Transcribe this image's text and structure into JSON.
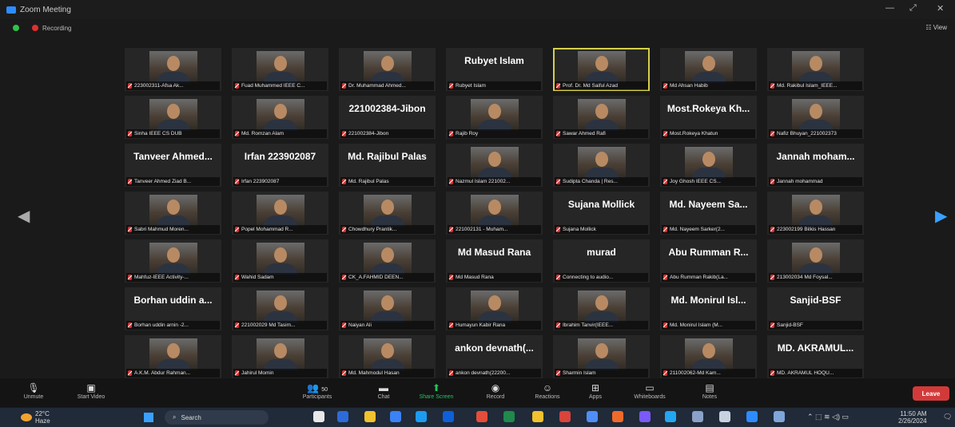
{
  "window": {
    "title": "Zoom Meeting",
    "status": "Recording",
    "view_label": "View"
  },
  "gallery": [
    {
      "name": "223002311-Afsa Ak...",
      "kind": "photo"
    },
    {
      "name": "Fuad Muhammed IEEE C...",
      "kind": "photo"
    },
    {
      "name": "Dr. Muhammad Ahmed...",
      "kind": "photo"
    },
    {
      "name": "Rubyet Islam",
      "kind": "text",
      "big": "Rubyet Islam"
    },
    {
      "name": "Prof. Dr. Md Saiful Azad",
      "kind": "photo",
      "active": true
    },
    {
      "name": "Md Ahsan Habib",
      "kind": "photo"
    },
    {
      "name": "Md. Rakibul Islam_IEEE...",
      "kind": "photo"
    },
    {
      "name": "Sinha IEEE CS DUB",
      "kind": "photo"
    },
    {
      "name": "Md. Romzan Alam",
      "kind": "photo"
    },
    {
      "name": "221002384-Jibon",
      "kind": "text",
      "big": "221002384-Jibon"
    },
    {
      "name": "Rajib Roy",
      "kind": "photo"
    },
    {
      "name": "Sawar Ahmed Rafi",
      "kind": "photo"
    },
    {
      "name": "Most.Rokeya Khatun",
      "kind": "text",
      "big": "Most.Rokeya Kh..."
    },
    {
      "name": "Nafiz Bhuyan_221002373",
      "kind": "photo"
    },
    {
      "name": "Tanveer Ahmed Ziad B...",
      "kind": "text",
      "big": "Tanveer Ahmed..."
    },
    {
      "name": "Irfan 223902087",
      "kind": "text",
      "big": "Irfan 223902087"
    },
    {
      "name": "Md. Rajibul Palas",
      "kind": "text",
      "big": "Md. Rajibul Palas"
    },
    {
      "name": "Nazmul Islam 221002...",
      "kind": "photo"
    },
    {
      "name": "Sudipta Chanda | Res...",
      "kind": "photo"
    },
    {
      "name": "Joy Ghosh IEEE CS...",
      "kind": "photo"
    },
    {
      "name": "Jannah mohammad",
      "kind": "text",
      "big": "Jannah moham..."
    },
    {
      "name": "Sabri Mahmud Moren...",
      "kind": "photo"
    },
    {
      "name": "Popel Mohammad R...",
      "kind": "photo"
    },
    {
      "name": "Chowdhury Prantik...",
      "kind": "photo"
    },
    {
      "name": "221002131 - Muham...",
      "kind": "photo"
    },
    {
      "name": "Sujana Mollick",
      "kind": "text",
      "big": "Sujana Mollick"
    },
    {
      "name": "Md. Nayeem Sarker(2...",
      "kind": "text",
      "big": "Md. Nayeem Sa..."
    },
    {
      "name": "223002199 Bilkis Hassan",
      "kind": "photo"
    },
    {
      "name": "Mahfuz-IEEE Activity-...",
      "kind": "photo"
    },
    {
      "name": "Wahid Sadam",
      "kind": "photo"
    },
    {
      "name": "CK_A.FAHMID DEEN...",
      "kind": "photo"
    },
    {
      "name": "Md Masud Rana",
      "kind": "text",
      "big": "Md Masud Rana"
    },
    {
      "name": "Connecting to audio...",
      "kind": "text",
      "big": "murad"
    },
    {
      "name": "Abu Rumman Rakib(La...",
      "kind": "text",
      "big": "Abu Rumman R..."
    },
    {
      "name": "213002034 Md Foysal...",
      "kind": "photo"
    },
    {
      "name": "Borhan uddin arnin -2...",
      "kind": "text",
      "big": "Borhan uddin a..."
    },
    {
      "name": "221002029 Md Tasim...",
      "kind": "photo"
    },
    {
      "name": "Naiyan Ali",
      "kind": "photo"
    },
    {
      "name": "Humayun Kabir Rana",
      "kind": "photo"
    },
    {
      "name": "Ibrahim Tanvir(IEEE...",
      "kind": "photo"
    },
    {
      "name": "Md. Monirul Islam (M...",
      "kind": "text",
      "big": "Md. Monirul Isl..."
    },
    {
      "name": "Sanjid-BSF",
      "kind": "text",
      "big": "Sanjid-BSF"
    },
    {
      "name": "A.K.M. Abdur Rahman...",
      "kind": "photo"
    },
    {
      "name": "Jahirul Momin",
      "kind": "photo"
    },
    {
      "name": "Md. Mahmodul Hasan",
      "kind": "photo"
    },
    {
      "name": "ankon devnath(22200...",
      "kind": "text",
      "big": "ankon devnath(..."
    },
    {
      "name": "Sharmin Islam",
      "kind": "photo"
    },
    {
      "name": "211002062-Md Kam...",
      "kind": "photo"
    },
    {
      "name": "MD. AKRAMUL HOQU...",
      "kind": "text",
      "big": "MD. AKRAMUL..."
    }
  ],
  "toolbar": {
    "unmute": "Unmute",
    "start_video": "Start Video",
    "participants": "Participants",
    "participants_count": "50",
    "chat": "Chat",
    "share_screen": "Share Screen",
    "record": "Record",
    "reactions": "Reactions",
    "apps": "Apps",
    "whiteboards": "Whiteboards",
    "notes": "Notes",
    "leave": "Leave"
  },
  "taskbar": {
    "weather_temp": "22°C",
    "weather_text": "Haze",
    "search": "Search",
    "time": "11:50 AM",
    "date": "2/26/2024"
  },
  "colors": {
    "active_border": "#d6d04b",
    "leave": "#d23a3a",
    "mic_muted": "#e02f2f",
    "share": "#22c55e",
    "nav_arrow": "#3aa0ff"
  }
}
